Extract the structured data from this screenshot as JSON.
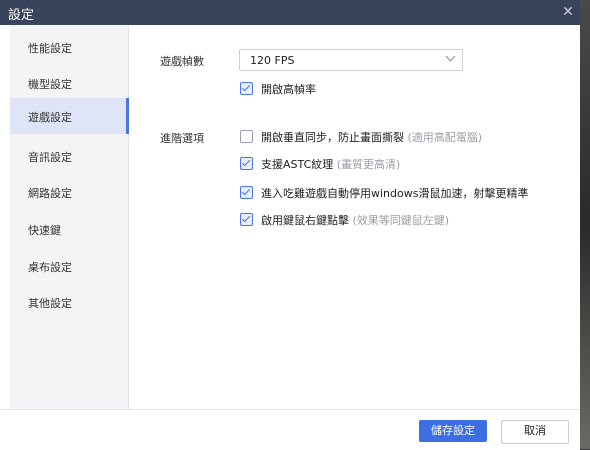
{
  "window": {
    "title": "設定",
    "close_icon": "close-icon"
  },
  "sidebar": {
    "items": [
      {
        "label": "性能設定",
        "active": false
      },
      {
        "label": "機型設定",
        "active": false
      },
      {
        "label": "遊戲設定",
        "active": true
      },
      {
        "label": "音訊設定",
        "active": false
      },
      {
        "label": "網路設定",
        "active": false
      },
      {
        "label": "快速鍵",
        "active": false
      },
      {
        "label": "桌布設定",
        "active": false
      },
      {
        "label": "其他設定",
        "active": false
      }
    ]
  },
  "game": {
    "fps_label": "遊戲幀數",
    "fps_value": "120 FPS",
    "high_fps_label": "開啟高幀率",
    "high_fps_checked": true,
    "advanced_label": "進階選項",
    "options": [
      {
        "text": "開啟垂直同步，防止畫面撕裂",
        "hint": "(適用高配電腦)",
        "checked": false
      },
      {
        "text": "支援ASTC紋理",
        "hint": "(畫質更高清)",
        "checked": true
      },
      {
        "text": "進入吃雞遊戲自動停用windows滑鼠加速，射擊更精準",
        "hint": "",
        "checked": true
      },
      {
        "text": "啟用鍵鼠右鍵點擊",
        "hint": "(效果等同鍵鼠左鍵)",
        "checked": true
      }
    ]
  },
  "footer": {
    "save_label": "儲存設定",
    "cancel_label": "取消"
  },
  "colors": {
    "titlebar": "#394359",
    "accent": "#3d6fe3",
    "active_nav": "#dfe5f6"
  }
}
